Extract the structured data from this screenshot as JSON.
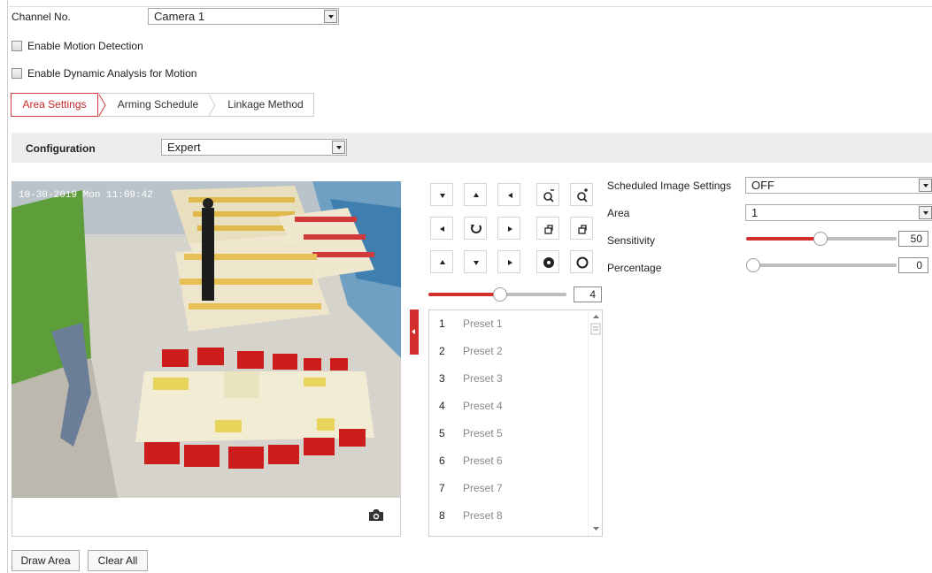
{
  "channel": {
    "label": "Channel No.",
    "value": "Camera 1"
  },
  "checkboxes": {
    "motion_detection": "Enable Motion Detection",
    "dynamic_analysis": "Enable Dynamic Analysis for Motion"
  },
  "tabs": [
    {
      "label": "Area Settings",
      "active": true
    },
    {
      "label": "Arming Schedule",
      "active": false
    },
    {
      "label": "Linkage Method",
      "active": false
    }
  ],
  "configuration": {
    "label": "Configuration",
    "value": "Expert"
  },
  "video": {
    "overlay_timestamp": "10-30-2019 Mon 11:09:42"
  },
  "ptz": {
    "speed_value": "4",
    "speed_level": 0.5
  },
  "presets": [
    {
      "num": "1",
      "name": "Preset 1"
    },
    {
      "num": "2",
      "name": "Preset 2"
    },
    {
      "num": "3",
      "name": "Preset 3"
    },
    {
      "num": "4",
      "name": "Preset 4"
    },
    {
      "num": "5",
      "name": "Preset 5"
    },
    {
      "num": "6",
      "name": "Preset 6"
    },
    {
      "num": "7",
      "name": "Preset 7"
    },
    {
      "num": "8",
      "name": "Preset 8"
    }
  ],
  "settings": {
    "scheduled_label": "Scheduled Image Settings",
    "scheduled_value": "OFF",
    "area_label": "Area",
    "area_value": "1",
    "sensitivity_label": "Sensitivity",
    "sensitivity_value": "50",
    "percentage_label": "Percentage",
    "percentage_value": "0"
  },
  "buttons": {
    "draw_area": "Draw Area",
    "clear_all": "Clear All"
  },
  "colors": {
    "accent": "#d32f2f",
    "tab_active_border": "#d23b3b"
  }
}
